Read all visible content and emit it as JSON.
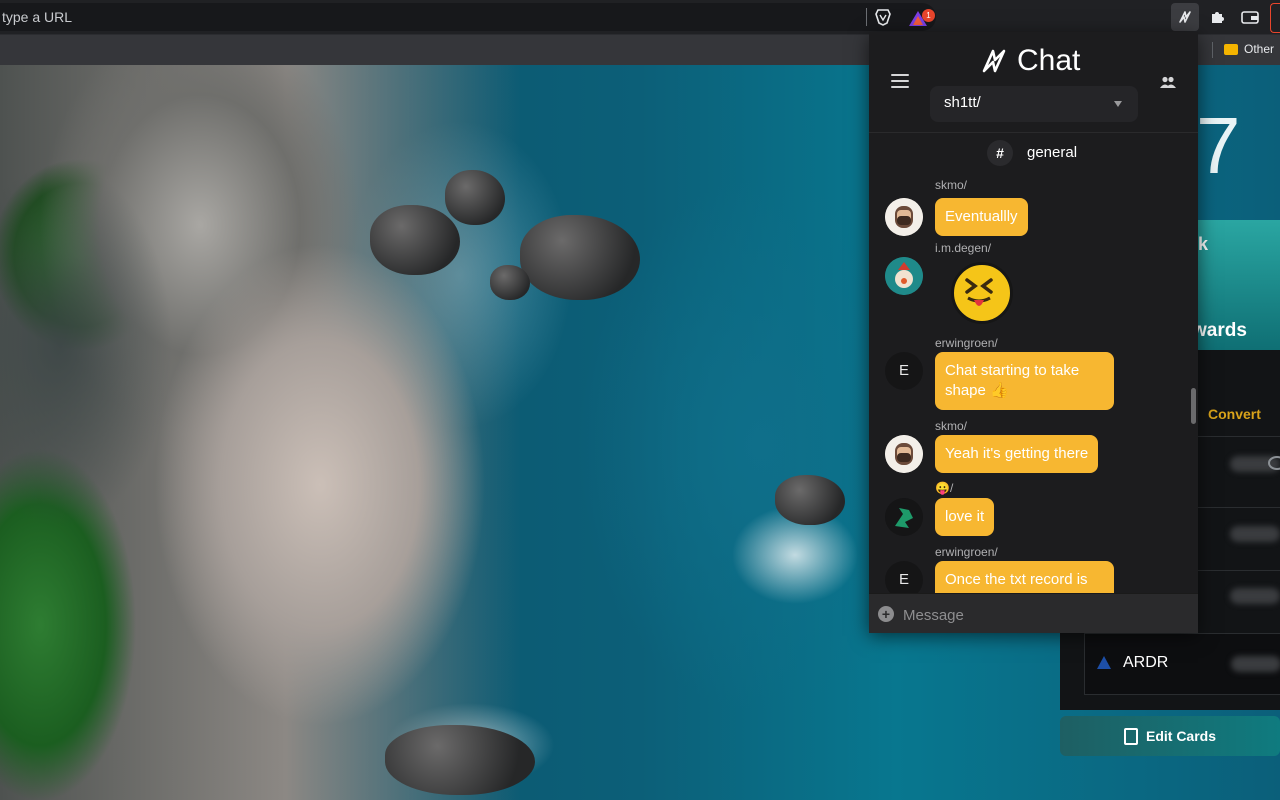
{
  "browser": {
    "address_placeholder": "type a URL",
    "rewards_badge": "1",
    "bookmarks_other": "Other"
  },
  "widget": {
    "digit": "7",
    "card_top": "k",
    "card_bottom": "wards",
    "convert": "Convert",
    "ardr": "ARDR",
    "edit_cards": "Edit Cards"
  },
  "chat": {
    "title": "Chat",
    "server": "sh1tt/",
    "channel": "general",
    "composer_placeholder": "Message",
    "messages": [
      {
        "author": "skmo/",
        "text": "Eventuallly"
      },
      {
        "author": "i.m.degen/",
        "text": ""
      },
      {
        "author": "erwingroen/",
        "text": "Chat starting to take shape 👍"
      },
      {
        "author": "skmo/",
        "text": "Yeah it's getting there"
      },
      {
        "author": "😛/",
        "text": "love it"
      },
      {
        "author": "erwingroen/",
        "text": "Once the txt record is"
      }
    ],
    "avatar_letters": {
      "erwingroen": "E"
    },
    "accent_color": "#f7b731"
  },
  "icons": [
    "brave-lion-icon",
    "rewards-triangle-icon",
    "chat-extension-icon",
    "puzzle-icon",
    "wallet-icon",
    "folder-icon",
    "menu-icon",
    "users-icon",
    "plus-icon",
    "eye-icon",
    "edit-icon",
    "ardor-icon"
  ]
}
